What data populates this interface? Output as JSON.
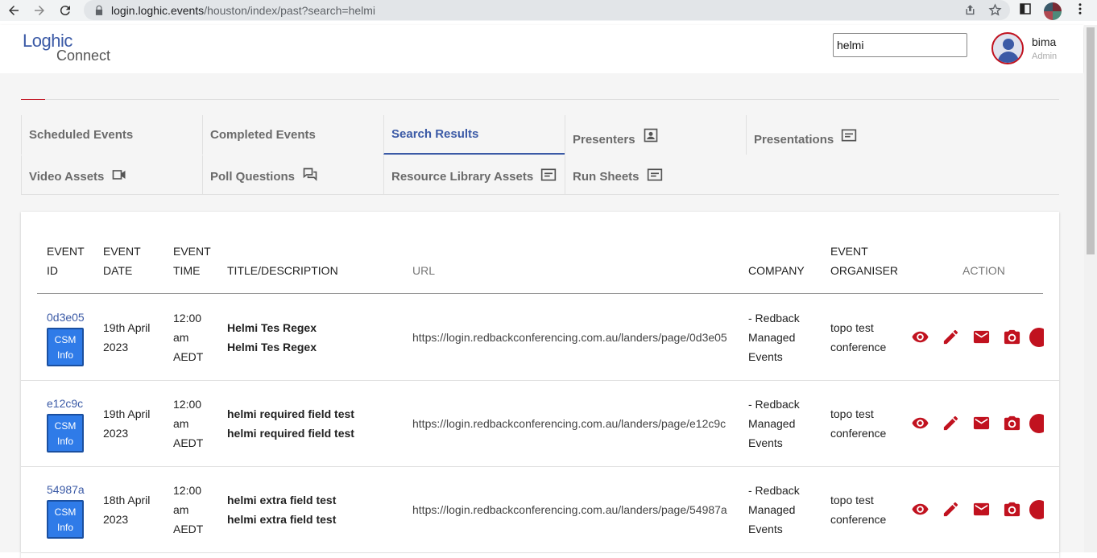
{
  "browser": {
    "url_host": "login.loghic.events",
    "url_path": "/houston/index/past?search=helmi"
  },
  "header": {
    "logo_line1": "Loghic",
    "logo_line2": "Connect",
    "search_value": "helmi",
    "user_name": "bima",
    "user_role": "Admin"
  },
  "tabs": [
    {
      "label": "Scheduled Events",
      "icon": ""
    },
    {
      "label": "Completed Events",
      "icon": ""
    },
    {
      "label": "Search Results",
      "icon": "",
      "active": true
    },
    {
      "label": "Presenters",
      "icon": "portrait-icon"
    },
    {
      "label": "Presentations",
      "icon": "slides-icon"
    },
    {
      "label": "Video Assets",
      "icon": "video-camera-icon"
    },
    {
      "label": "Poll Questions",
      "icon": "chat-bubbles-icon"
    },
    {
      "label": "Resource Library Assets",
      "icon": "slides-icon"
    },
    {
      "label": "Run Sheets",
      "icon": "slides-icon"
    }
  ],
  "table": {
    "headers": {
      "event_id_1": "EVENT",
      "event_id_2": "ID",
      "event_date_1": "EVENT",
      "event_date_2": "DATE",
      "event_time_1": "EVENT",
      "event_time_2": "TIME",
      "title": "TITLE/DESCRIPTION",
      "url": "URL",
      "company": "COMPANY",
      "organiser_1": "EVENT",
      "organiser_2": "ORGANISER",
      "action": "ACTION"
    },
    "csm_label_1": "CSM",
    "csm_label_2": "Info",
    "rows": [
      {
        "id": "0d3e05",
        "date_1": "19th April",
        "date_2": "2023",
        "time_1": "12:00",
        "time_2": "am",
        "time_3": "AEDT",
        "title": "Helmi Tes Regex",
        "description": "Helmi Tes Regex",
        "url": "https://login.redbackconferencing.com.au/landers/page/0d3e05",
        "company_1": "- Redback",
        "company_2": "Managed",
        "company_3": "Events",
        "organiser_1": "topo test",
        "organiser_2": "conference"
      },
      {
        "id": "e12c9c",
        "date_1": "19th April",
        "date_2": "2023",
        "time_1": "12:00",
        "time_2": "am",
        "time_3": "AEDT",
        "title": "helmi required field test",
        "description": "helmi required field test",
        "url": "https://login.redbackconferencing.com.au/landers/page/e12c9c",
        "company_1": "- Redback",
        "company_2": "Managed",
        "company_3": "Events",
        "organiser_1": "topo test",
        "organiser_2": "conference"
      },
      {
        "id": "54987a",
        "date_1": "18th April",
        "date_2": "2023",
        "time_1": "12:00",
        "time_2": "am",
        "time_3": "AEDT",
        "title": "helmi extra field test",
        "description": "helmi extra field test",
        "url": "https://login.redbackconferencing.com.au/landers/page/54987a",
        "company_1": "- Redback",
        "company_2": "Managed",
        "company_3": "Events",
        "organiser_1": "topo test",
        "organiser_2": "conference"
      }
    ]
  },
  "colors": {
    "brand_blue": "#3b5aa6",
    "action_red": "#c1121f",
    "csm_button": "#2f7be8"
  }
}
